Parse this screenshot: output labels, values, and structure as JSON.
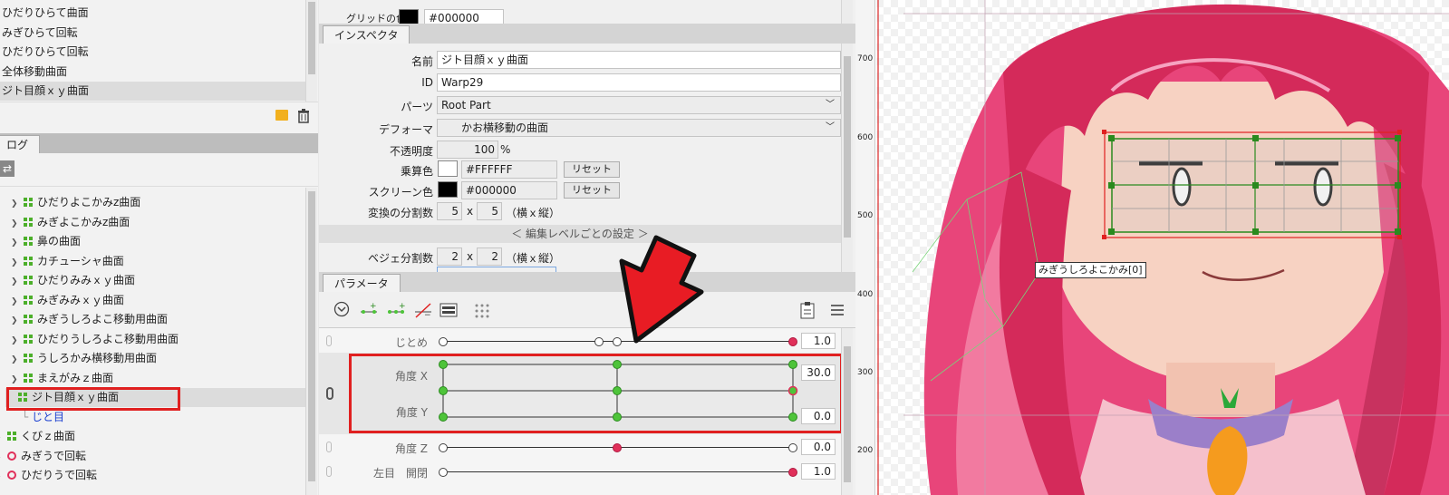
{
  "deformer_list": {
    "items": [
      "ひだりひらて曲面",
      "みぎひらて回転",
      "ひだりひらて回転",
      "全体移動曲面",
      "ジト目顔ｘｙ曲面"
    ],
    "selected_index": 4
  },
  "log_tab": {
    "label": "ログ"
  },
  "tree": {
    "items": [
      {
        "label": "ひだりよこかみz曲面",
        "type": "warp"
      },
      {
        "label": "みぎよこかみz曲面",
        "type": "warp"
      },
      {
        "label": "鼻の曲面",
        "type": "warp"
      },
      {
        "label": "カチューシャ曲面",
        "type": "warp"
      },
      {
        "label": "ひだりみみｘｙ曲面",
        "type": "warp"
      },
      {
        "label": "みぎみみｘｙ曲面",
        "type": "warp"
      },
      {
        "label": "みぎうしろよこ移動用曲面",
        "type": "warp"
      },
      {
        "label": "ひだりうしろよこ移動用曲面",
        "type": "warp"
      },
      {
        "label": "うしろかみ横移動用曲面",
        "type": "warp"
      },
      {
        "label": "まえがみｚ曲面",
        "type": "warp"
      }
    ],
    "selected_label": "ジト目顔ｘｙ曲面",
    "child_label": "じと目",
    "after_items": [
      {
        "label": "くびｚ曲面",
        "type": "warp"
      },
      {
        "label": "みぎうで回転",
        "type": "rotation"
      },
      {
        "label": "ひだりうで回転",
        "type": "rotation"
      }
    ]
  },
  "top_section": {
    "grid_color_label": "グリッドの色",
    "grid_color_value": "#000000"
  },
  "inspector": {
    "tab_label": "インスペクタ",
    "name_label": "名前",
    "name_value": "ジト目顔ｘｙ曲面",
    "id_label": "ID",
    "id_value": "Warp29",
    "parts_label": "パーツ",
    "parts_value": "Root Part",
    "deformer_label": "デフォーマ",
    "deformer_value": "かお横移動の曲面",
    "opacity_label": "不透明度",
    "opacity_value": "100",
    "opacity_unit": "%",
    "multiply_label": "乗算色",
    "multiply_value": "#FFFFFF",
    "screen_label": "スクリーン色",
    "screen_value": "#000000",
    "reset_label": "リセット",
    "transform_div_label": "変換の分割数",
    "transform_div_x": "5",
    "transform_div_y": "5",
    "times": "x",
    "div_suffix": "（横ｘ縦）",
    "edit_level_header": "＜ 編集レベルごとの設定 ＞",
    "bezier_div_label": "ベジェ分割数",
    "bezier_div_x": "2",
    "bezier_div_y": "2"
  },
  "parameters": {
    "tab_label": "パラメータ",
    "rows": [
      {
        "name": "じとめ",
        "value": "1.0"
      },
      {
        "name": "角度 X",
        "value": "30.0"
      },
      {
        "name": "角度 Y",
        "value": "0.0"
      },
      {
        "name": "角度 Z",
        "value": "0.0"
      },
      {
        "name": "左目　開閉",
        "value": "1.0"
      }
    ]
  },
  "canvas": {
    "ruler_ticks": [
      "700",
      "600",
      "500",
      "400",
      "300",
      "200"
    ],
    "tooltip": "みぎうしろよこかみ[0]"
  },
  "colors": {
    "highlight_red": "#e02020",
    "selection_gray": "#dcdcdc",
    "warp_green": "#4caf2a",
    "knot_red": "#e0305a",
    "hair_pink": "#e8457a",
    "skin": "#f7d2c2",
    "arrow_red": "#e81c24"
  }
}
